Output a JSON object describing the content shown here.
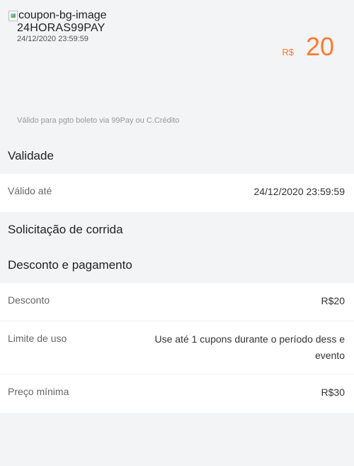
{
  "coupon": {
    "image_alt": "coupon-bg-image",
    "code": "24HORAS99PAY",
    "expiry": "24/12/2020 23:59:59",
    "currency": "R$",
    "amount": "20",
    "note": "Válido para pgto boleto via 99Pay ou C.Crédito"
  },
  "validity": {
    "title": "Validade",
    "rows": [
      {
        "label": "Válido até",
        "value": "24/12/2020 23:59:59"
      }
    ]
  },
  "ride_request": {
    "title": "Solicitação de corrida"
  },
  "discount_payment": {
    "title": "Desconto e pagamento",
    "rows": [
      {
        "label": "Desconto",
        "value": "R$20"
      },
      {
        "label": "Limite de uso",
        "value": "Use até 1 cupons durante o período dess e evento"
      },
      {
        "label": "Preço mínima",
        "value": "R$30"
      }
    ]
  },
  "colors": {
    "accent": "#ff7a2f",
    "background": "#f3f4f5",
    "card": "#ffffff"
  }
}
